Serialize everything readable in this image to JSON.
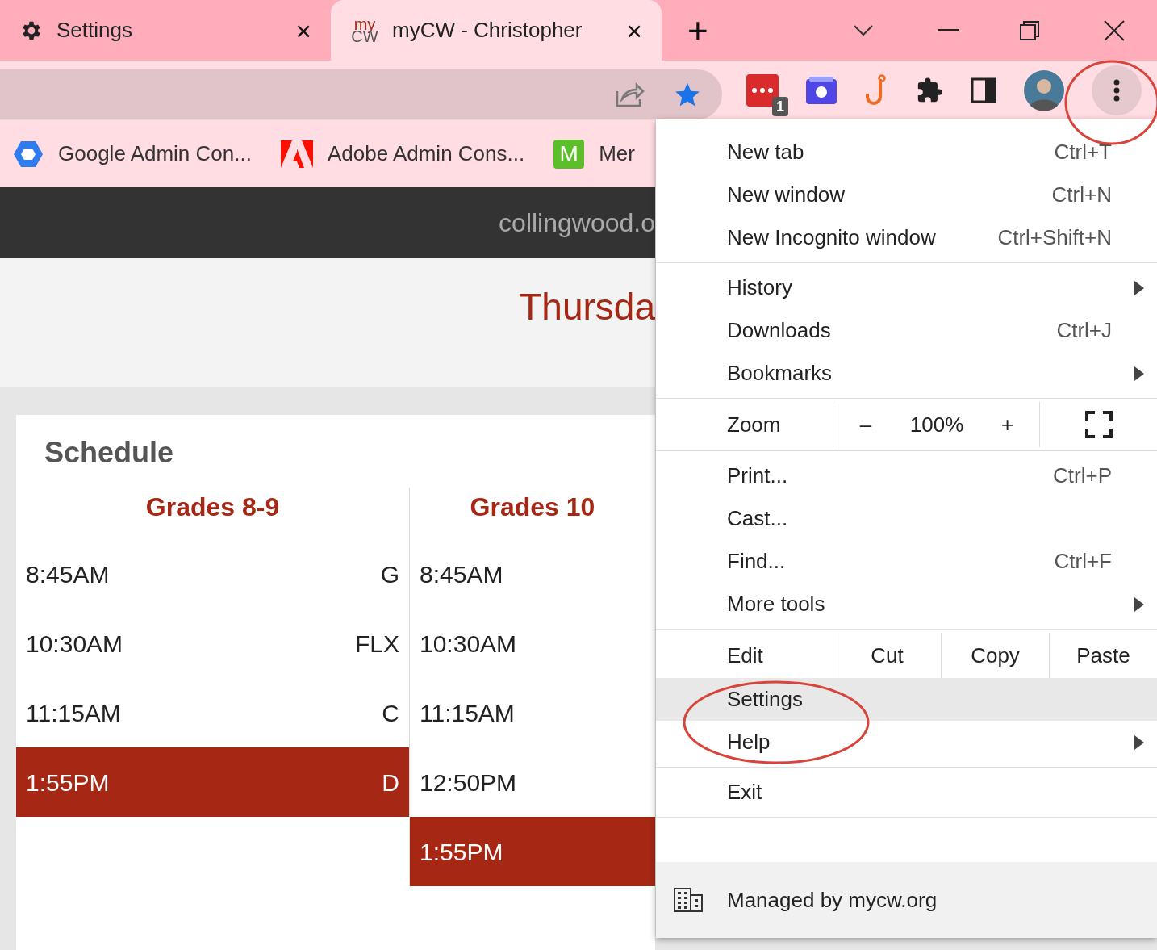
{
  "tabs": [
    {
      "kind": "settings",
      "title": "Settings",
      "selected": false,
      "close": "×"
    },
    {
      "kind": "site",
      "favicon_text": [
        "my",
        "CW"
      ],
      "title": "myCW - Christopher",
      "selected": true,
      "close": "×"
    }
  ],
  "new_tab": "+",
  "extensions": [
    {
      "kind": "dots",
      "badge": "1"
    },
    {
      "kind": "box"
    },
    {
      "kind": "hook"
    },
    {
      "kind": "puzzle"
    },
    {
      "kind": "panel"
    }
  ],
  "bookmarks": [
    {
      "kind": "hexagon",
      "label": "Google Admin Con..."
    },
    {
      "kind": "adobe",
      "label": "Adobe Admin Cons..."
    },
    {
      "kind": "letter",
      "icon_text": "M",
      "label": "Mer"
    }
  ],
  "page": {
    "header_text": "collingwood.o",
    "date_title": "Thursda",
    "card": {
      "title": "Schedule",
      "columns": [
        {
          "heading": "Grades 8-9",
          "rows": [
            {
              "time": "8:45AM",
              "block": "G",
              "highlighted": false
            },
            {
              "time": "10:30AM",
              "block": "FLX",
              "highlighted": false
            },
            {
              "time": "11:15AM",
              "block": "C",
              "highlighted": false
            },
            {
              "time": "1:55PM",
              "block": "D",
              "highlighted": true
            }
          ]
        },
        {
          "heading": "Grades 10",
          "rows": [
            {
              "time": "8:45AM",
              "highlighted": false
            },
            {
              "time": "10:30AM",
              "highlighted": false
            },
            {
              "time": "11:15AM",
              "highlighted": false
            },
            {
              "time": "12:50PM",
              "highlighted": false
            },
            {
              "time": "1:55PM",
              "highlighted": true
            }
          ]
        }
      ]
    }
  },
  "menu": {
    "sections": [
      [
        {
          "kind": "item",
          "label": "New tab",
          "shortcut": "Ctrl+T",
          "submenu": false,
          "highlighted": false
        },
        {
          "kind": "item",
          "label": "New window",
          "shortcut": "Ctrl+N",
          "submenu": false,
          "highlighted": false
        },
        {
          "kind": "item",
          "label": "New Incognito window",
          "shortcut": "Ctrl+Shift+N",
          "submenu": false,
          "highlighted": false
        }
      ],
      [
        {
          "kind": "item",
          "label": "History",
          "submenu": true,
          "highlighted": false
        },
        {
          "kind": "item",
          "label": "Downloads",
          "shortcut": "Ctrl+J",
          "submenu": false,
          "highlighted": false
        },
        {
          "kind": "item",
          "label": "Bookmarks",
          "submenu": true,
          "highlighted": false
        }
      ],
      [
        {
          "kind": "zoom",
          "label": "Zoom",
          "minus": "–",
          "value": "100%",
          "plus": "+"
        }
      ],
      [
        {
          "kind": "item",
          "label": "Print...",
          "shortcut": "Ctrl+P",
          "submenu": false,
          "highlighted": false
        },
        {
          "kind": "item",
          "label": "Cast...",
          "submenu": false,
          "highlighted": false
        },
        {
          "kind": "item",
          "label": "Find...",
          "shortcut": "Ctrl+F",
          "submenu": false,
          "highlighted": false
        },
        {
          "kind": "item",
          "label": "More tools",
          "submenu": true,
          "highlighted": false
        }
      ],
      [
        {
          "kind": "edit",
          "label": "Edit",
          "actions": [
            "Cut",
            "Copy",
            "Paste"
          ]
        },
        {
          "kind": "item",
          "label": "Settings",
          "submenu": false,
          "highlighted": true
        },
        {
          "kind": "item",
          "label": "Help",
          "submenu": true,
          "highlighted": false
        }
      ],
      [
        {
          "kind": "item",
          "label": "Exit",
          "submenu": false,
          "highlighted": false
        }
      ],
      [
        {
          "kind": "managed",
          "label": "Managed by mycw.org"
        }
      ]
    ]
  }
}
